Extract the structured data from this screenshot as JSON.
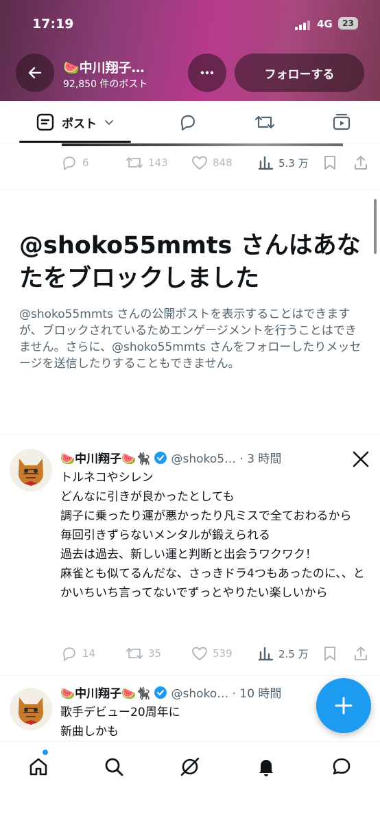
{
  "status_bar": {
    "time": "17:19",
    "network": "4G",
    "battery": "23"
  },
  "header": {
    "profile_name": "🍉中川翔子…",
    "post_count": "92,850 件のポスト",
    "follow_label": "フォローする"
  },
  "tabs": {
    "post_label": "ポスト"
  },
  "prev_post_actions": {
    "replies": "6",
    "reposts": "143",
    "likes": "848",
    "views": "5.3 万"
  },
  "block_notice": {
    "title": "@shoko55mmts さんはあなたをブロックしました",
    "description": "@shoko55mmts さんの公開ポストを表示することはできますが、ブロックされているためエンゲージメントを行うことはできません。さらに、@shoko55mmts さんをフォローしたりメッセージを送信したりすることもできません。"
  },
  "posts": [
    {
      "name": "🍉中川翔子🍉🐈‍⬛",
      "handle": "@shoko5… · 3 時間",
      "body": "トルネコやシレン\nどんなに引きが良かったとしても\n調子に乗ったり運が悪かったり凡ミスで全ておわるから\n毎回引きずらないメンタルが鍛えられる\n過去は過去、新しい運と判断と出会うワクワク！\n麻雀とも似てるんだな、さっきドラ4つもあったのに、、とかいちいち言ってないでずっとやりたい楽しいから",
      "replies": "14",
      "reposts": "35",
      "likes": "539",
      "views": "2.5 万"
    },
    {
      "name": "🍉中川翔子🍉🐈‍⬛",
      "handle": "@shoko… · 10 時間",
      "body": "歌手デビュー20周年に\n新曲しかも"
    }
  ],
  "colors": {
    "accent": "#1d9bf0",
    "text": "#0f1419",
    "muted": "#536471"
  }
}
